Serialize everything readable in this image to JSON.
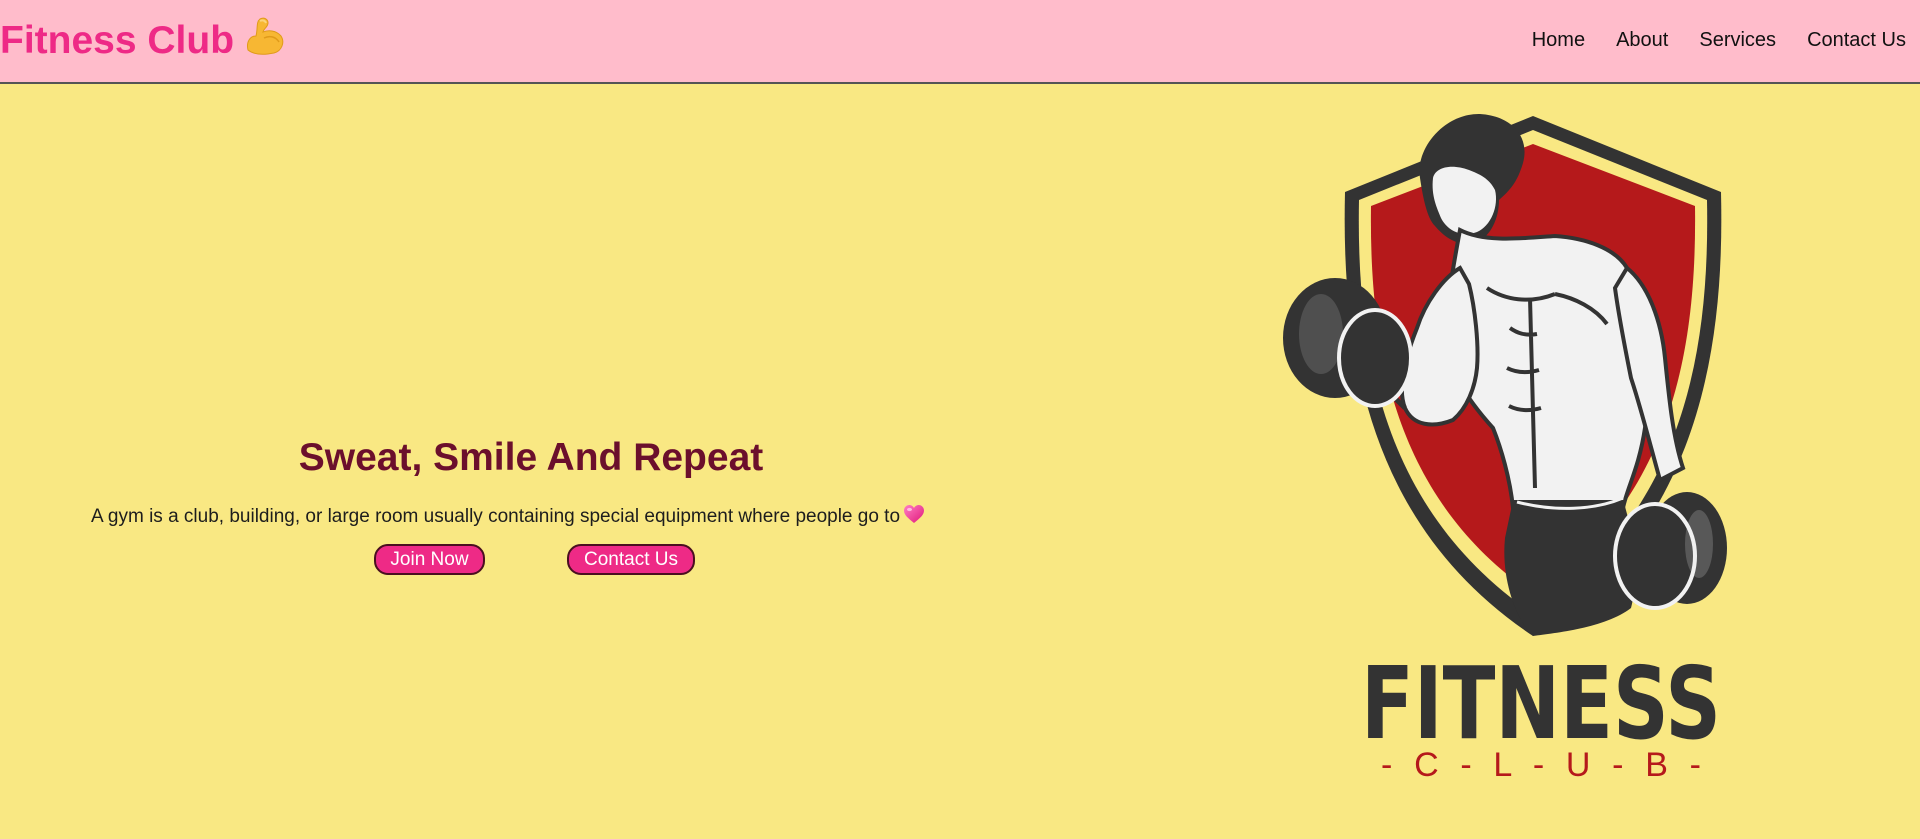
{
  "navbar": {
    "brand": "Fitness Club",
    "brand_icon": "flexed-biceps-icon",
    "links": [
      "Home",
      "About",
      "Services",
      "Contact Us"
    ],
    "colors": {
      "background": "#ffbccb",
      "brand": "#ee2a86"
    }
  },
  "hero": {
    "title": "Sweat, Smile And Repeat",
    "description": "A gym is a club, building, or large room usually containing special equipment where people go to",
    "description_icon": "pink-heart-icon",
    "join_button": "Join Now",
    "contact_button": "Contact Us",
    "colors": {
      "background": "#f9e883",
      "title": "#6b0f2c",
      "button": "#ee2a86"
    }
  },
  "logo": {
    "title": "FITNESS",
    "subtitle": "- C - L - U - B -",
    "image": "bodybuilder-with-dumbbells-shield-emblem",
    "colors": {
      "shield": "#b5191b",
      "dark": "#333333",
      "accent": "#f9e883"
    }
  }
}
